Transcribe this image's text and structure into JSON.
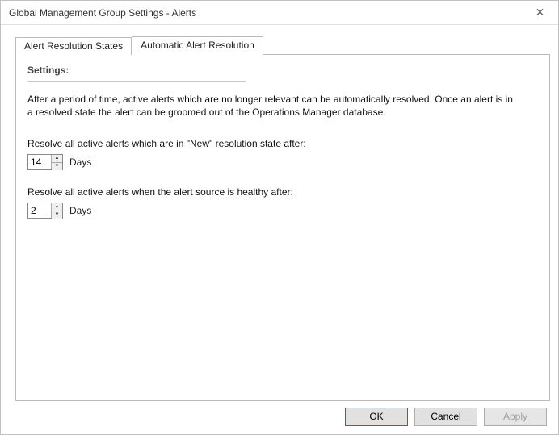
{
  "window": {
    "title": "Global Management Group Settings - Alerts"
  },
  "tabs": {
    "tab1": "Alert Resolution States",
    "tab2": "Automatic Alert Resolution"
  },
  "section": {
    "title": "Settings:",
    "description": "After a period of time, active alerts which are no longer relevant can be automatically resolved. Once an alert is in a resolved state the alert can be groomed out of the Operations Manager database."
  },
  "field1": {
    "label": "Resolve all active alerts which are in \"New\" resolution state after:",
    "value": "14",
    "unit": "Days"
  },
  "field2": {
    "label": "Resolve all active alerts when the alert source is healthy after:",
    "value": "2",
    "unit": "Days"
  },
  "buttons": {
    "ok": "OK",
    "cancel": "Cancel",
    "apply": "Apply"
  }
}
